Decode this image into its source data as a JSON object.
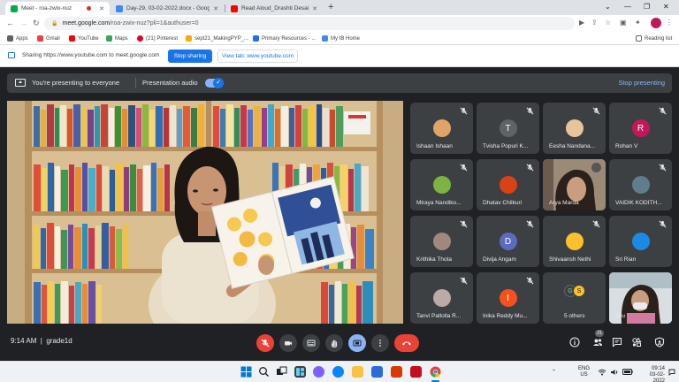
{
  "browser": {
    "tabs": [
      {
        "title": "Meet - roa-zwix-nuz",
        "color": "#00ac47"
      },
      {
        "title": "Day-29, 03-02-2022.docx - Goog...",
        "color": "#4285f4"
      },
      {
        "title": "Read Aloud_Drashti Desai - ...",
        "color": "#ff0000"
      }
    ],
    "new_tab": "+",
    "url_host": "meet.google.com",
    "url_path": "/roa-zwix-nuz?pli=1&authuser=0"
  },
  "bookmarks": [
    {
      "label": "Apps",
      "color": "#5f6368"
    },
    {
      "label": "Gmail",
      "color": "#ea4335"
    },
    {
      "label": "YouTube",
      "color": "#ff0000"
    },
    {
      "label": "Maps",
      "color": "#34a853"
    },
    {
      "label": "(21) Pinterest",
      "color": "#e60023"
    },
    {
      "label": "sept21_MakingPYP_...",
      "color": "#f9ab00"
    },
    {
      "label": "Primary Resources - ...",
      "color": "#1a73e8"
    },
    {
      "label": "My IB Home",
      "color": "#4285f4"
    },
    {
      "label": "Reading list",
      "color": "#5f6368"
    }
  ],
  "share_bar": {
    "text": "Sharing https://www.youtube.com to meet.google.com",
    "stop_label": "Stop sharing",
    "view_label": "View tab: www.youtube.com"
  },
  "presenting": {
    "text": "You're presenting to everyone",
    "audio_label": "Presentation audio",
    "audio_on": true,
    "stop_label": "Stop presenting"
  },
  "participants": [
    {
      "name": "Ishaan Ishaan",
      "type": "photo",
      "color": "#e0a36a"
    },
    {
      "name": "Tvisha Popuri K...",
      "type": "letter",
      "letter": "T",
      "color": "#5f6368"
    },
    {
      "name": "Eesha Nandana...",
      "type": "photo",
      "color": "#e8c39e"
    },
    {
      "name": "Rohan V",
      "type": "letter",
      "letter": "R",
      "color": "#c2185b"
    },
    {
      "name": "Miraya Nandiko...",
      "type": "photo",
      "color": "#7cb342"
    },
    {
      "name": "Dhatav Chilkuri",
      "type": "photo",
      "color": "#d84315"
    },
    {
      "name": "Arya Marda",
      "type": "video",
      "color": "#8d7a6a"
    },
    {
      "name": "VAIDIK KODITH...",
      "type": "photo",
      "color": "#607d8b"
    },
    {
      "name": "Krithika Thota",
      "type": "photo",
      "color": "#a1887f"
    },
    {
      "name": "Divija Angam",
      "type": "letter",
      "letter": "D",
      "color": "#5c6bc0"
    },
    {
      "name": "Shivaansh Nethi",
      "type": "photo",
      "color": "#fbc02d"
    },
    {
      "name": "Sri Rian",
      "type": "photo",
      "color": "#1e88e5"
    },
    {
      "name": "Tanvi Patlolla R...",
      "type": "photo",
      "color": "#bcaaa4"
    },
    {
      "name": "Inika Reddy Mu...",
      "type": "letter",
      "letter": "I",
      "color": "#f4511e"
    },
    {
      "name": "5 others",
      "type": "others",
      "letters": [
        "G",
        "S"
      ],
      "color": "#3c4043"
    },
    {
      "name": "You",
      "type": "video",
      "color": "#cfd8dc"
    }
  ],
  "meeting": {
    "time": "9:14 AM",
    "code": "grade1d",
    "participant_count": "21"
  },
  "taskbar": {
    "lang": "ENG",
    "region": "US",
    "clock": "09:14",
    "date": "03-02-2022"
  }
}
